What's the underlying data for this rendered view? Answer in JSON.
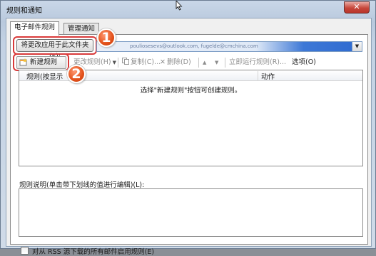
{
  "window": {
    "title": "规则和通知",
    "close_glyph": "✕"
  },
  "tabs": [
    {
      "label": "电子邮件规则",
      "active": true
    },
    {
      "label": "管理通知",
      "active": false
    }
  ],
  "apply_folder_button": "将更改应用于此文件夹(F):",
  "account_combo_value": "pouliosesevs@outlook.com, fugelde@cmchina.com",
  "toolbar": {
    "new_rule": "新建规则(N)...",
    "change_rule": "更改规则(H)",
    "copy": "复制(C)...",
    "delete": "删除(D)",
    "move_up": "▲",
    "move_down": "▼",
    "run_rules": "立即运行规则(R)...",
    "options": "选项(O)"
  },
  "list": {
    "col_rule": "规则(按显示",
    "col_action": "动作",
    "empty_message": "选择\"新建规则\"按钮可创建规则。"
  },
  "description_label": "规则说明(单击带下划线的值进行编辑)(L):",
  "rss_label": "对从 RSS 源下载的所有邮件启用规则(E)",
  "markers": [
    "1",
    "2"
  ],
  "colors": {
    "highlight_ring": "#d93a3a",
    "marker": "#e25019",
    "close_button": "#c7473b"
  }
}
